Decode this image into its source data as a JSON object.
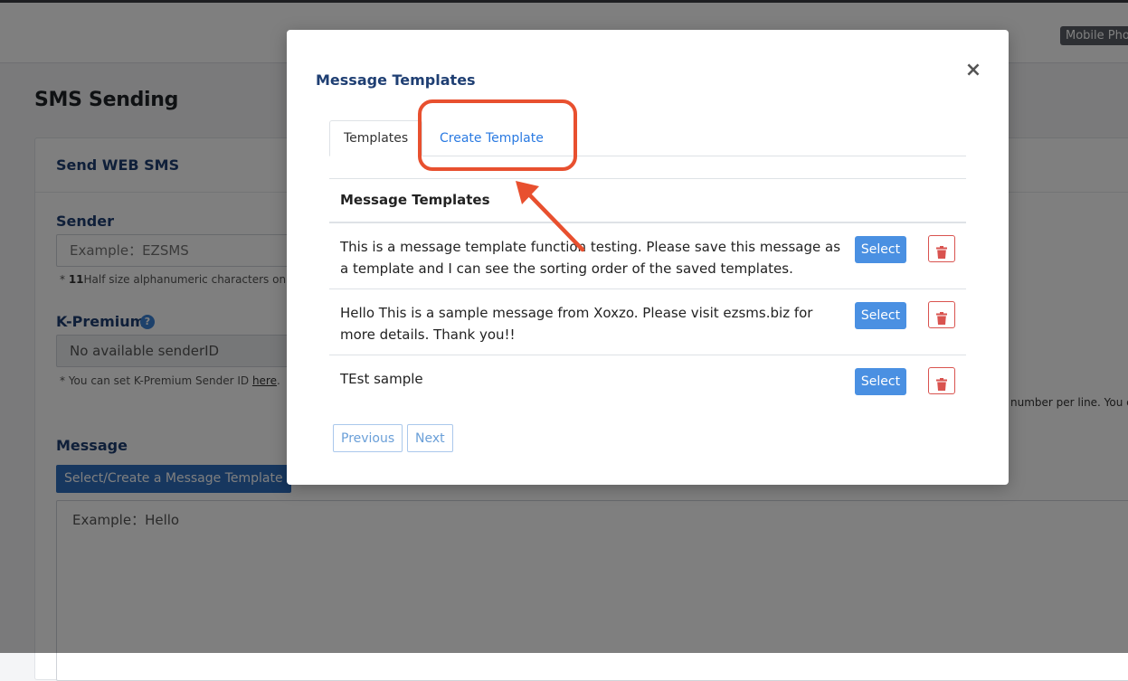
{
  "header": {
    "mobile_badge": "Mobile Pho"
  },
  "page": {
    "title": "SMS Sending",
    "card_title": "Send WEB SMS",
    "sender": {
      "label": "Sender",
      "placeholder": "Example：EZSMS",
      "hint_prefix": "* ",
      "hint_bold": "11",
      "hint_rest": "Half size alphanumeric characters only."
    },
    "kpremium": {
      "label": "K-Premium",
      "help_icon": "question-circle-icon",
      "value": "No available senderID",
      "hint_text": "* You can set K-Premium Sender ID ",
      "hint_link": "here",
      "hint_end": "."
    },
    "side_hint": "number per line. You c",
    "message": {
      "label": "Message",
      "template_button": "Select/Create a Message Template",
      "placeholder": "Example：Hello"
    }
  },
  "modal": {
    "title": "Message Templates",
    "close_icon": "close-icon",
    "tabs": [
      {
        "label": "Templates",
        "active": true
      },
      {
        "label": "Create Template",
        "active": false
      }
    ],
    "table_header": "Message Templates",
    "rows": [
      {
        "text": "This is a message template function testing. Please save this message as a template and I can see the sorting order of the saved templates.",
        "select_label": "Select"
      },
      {
        "text": "Hello This is a sample message from Xoxzo. Please visit ezsms.biz for more details. Thank you!!",
        "select_label": "Select"
      },
      {
        "text": "TEst sample",
        "select_label": "Select"
      }
    ],
    "pager": {
      "previous": "Previous",
      "next": "Next"
    }
  },
  "colors": {
    "accent_blue": "#4a90e2",
    "title_navy": "#1f3f73",
    "delete_red": "#d9534f",
    "annotation_red": "#e8502f"
  }
}
